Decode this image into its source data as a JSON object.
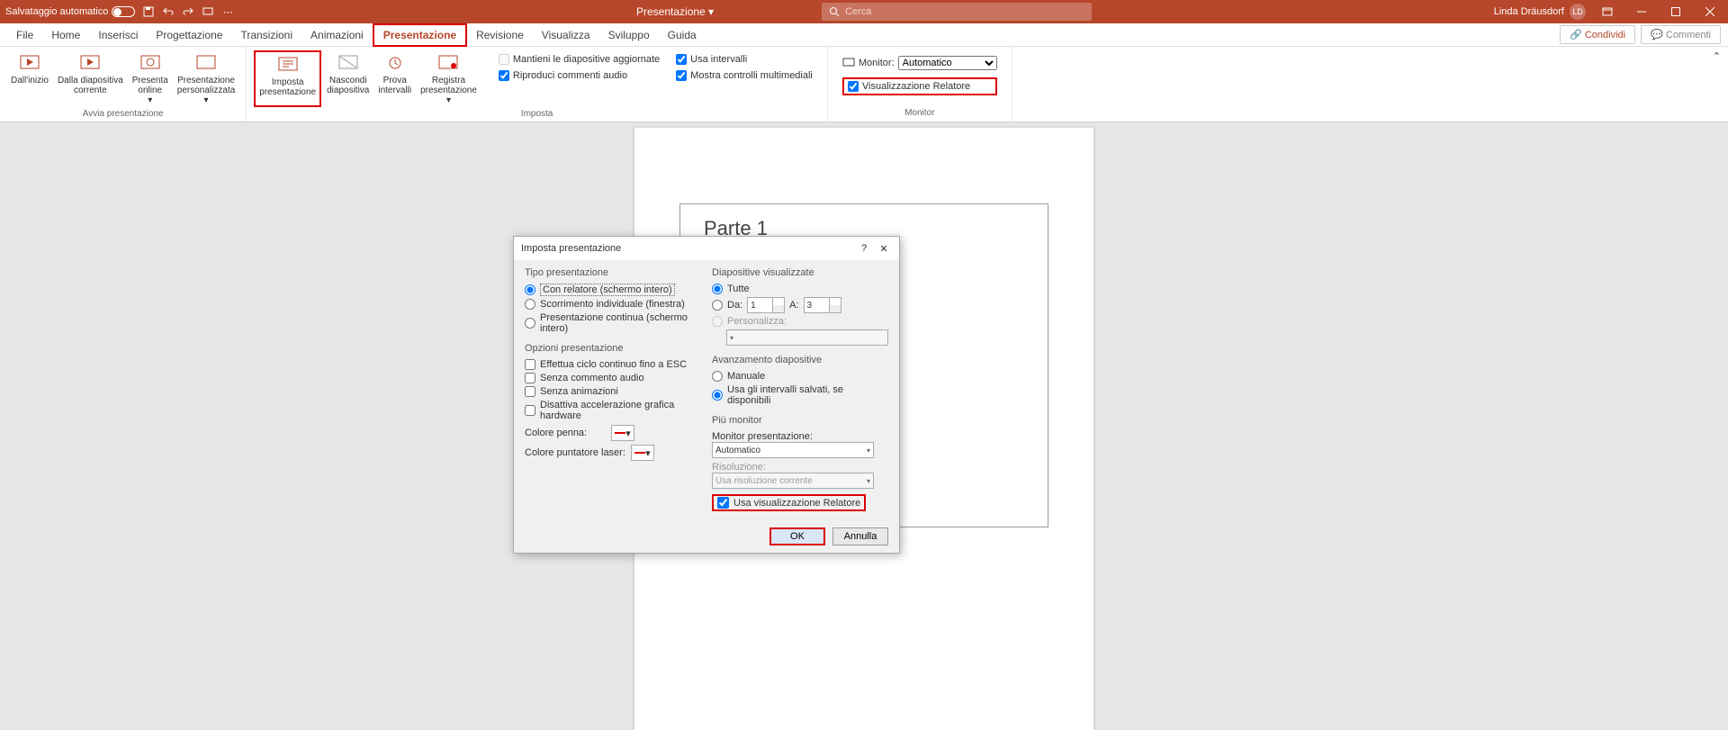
{
  "titlebar": {
    "autosave": "Salvataggio automatico",
    "doc": "Presentazione",
    "search_placeholder": "Cerca",
    "user": "Linda Dräusdorf",
    "initials": "LD"
  },
  "tabs": {
    "file": "File",
    "home": "Home",
    "inserisci": "Inserisci",
    "progettazione": "Progettazione",
    "transizioni": "Transizioni",
    "animazioni": "Animazioni",
    "presentazione": "Presentazione",
    "revisione": "Revisione",
    "visualizza": "Visualizza",
    "sviluppo": "Sviluppo",
    "guida": "Guida",
    "condividi": "Condividi",
    "commenti": "Commenti"
  },
  "ribbon": {
    "dall_inizio": "Dall'inizio",
    "dalla_diap": "Dalla diapositiva\ncorrente",
    "presenta_online": "Presenta\nonline",
    "pers": "Presentazione\npersonalizzata",
    "imposta": "Imposta\npresentazione",
    "nascondi": "Nascondi\ndiapositiva",
    "prova": "Prova\nintervalli",
    "registra": "Registra\npresentazione",
    "chk_aggiornate": "Mantieni le diapositive aggiornate",
    "chk_riproduci": "Riproduci commenti audio",
    "chk_intervalli": "Usa intervalli",
    "chk_controlli": "Mostra controlli multimediali",
    "monitor_lbl": "Monitor:",
    "monitor_val": "Automatico",
    "chk_relatore": "Visualizzazione Relatore",
    "grp_avvia": "Avvia presentazione",
    "grp_imposta": "Imposta",
    "grp_monitor": "Monitor"
  },
  "slide": {
    "title": "Parte 1"
  },
  "dialog": {
    "title": "Imposta presentazione",
    "tipo_hdr": "Tipo presentazione",
    "tipo_relatore": "Con relatore (schermo intero)",
    "tipo_scorr": "Scorrimento individuale (finestra)",
    "tipo_cont": "Presentazione continua (schermo intero)",
    "opz_hdr": "Opzioni presentazione",
    "opz_ciclo": "Effettua ciclo continuo fino a ESC",
    "opz_senza_audio": "Senza commento audio",
    "opz_senza_anim": "Senza animazioni",
    "opz_disattiva": "Disattiva accelerazione grafica hardware",
    "colore_penna": "Colore penna:",
    "colore_laser": "Colore puntatore laser:",
    "diap_hdr": "Diapositive visualizzate",
    "diap_tutte": "Tutte",
    "diap_da": "Da:",
    "diap_da_val": "1",
    "diap_a": "A:",
    "diap_a_val": "3",
    "diap_pers": "Personalizza:",
    "av_hdr": "Avanzamento diapositive",
    "av_manuale": "Manuale",
    "av_intervalli": "Usa gli intervalli salvati, se disponibili",
    "piu_hdr": "Più monitor",
    "mon_pres": "Monitor presentazione:",
    "mon_val": "Automatico",
    "risoluzione": "Risoluzione:",
    "ris_val": "Usa risoluzione corrente",
    "usa_relatore": "Usa visualizzazione Relatore",
    "ok": "OK",
    "annulla": "Annulla"
  }
}
